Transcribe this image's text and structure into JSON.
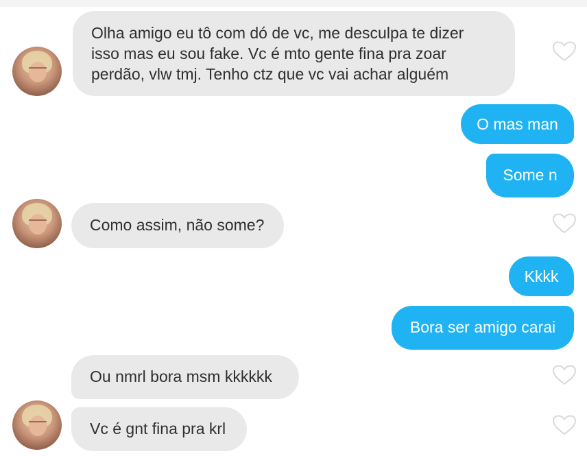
{
  "conversation": {
    "messages": [
      {
        "sender": "them",
        "text": "Olha amigo eu tô com dó de vc, me desculpa te dizer\nisso mas eu sou fake. Vc é mto gente fina pra zoar\nperdão, vlw tmj. Tenho ctz que vc vai achar alguém"
      },
      {
        "sender": "me",
        "text": "O mas man"
      },
      {
        "sender": "me",
        "text": "Some n"
      },
      {
        "sender": "them",
        "text": "Como assim, não some?"
      },
      {
        "sender": "me",
        "text": "Kkkk"
      },
      {
        "sender": "me",
        "text": "Bora ser amigo carai"
      },
      {
        "sender": "them",
        "text": "Ou nmrl bora msm kkkkkk"
      },
      {
        "sender": "them",
        "text": "Vc é gnt fina pra krl"
      }
    ]
  },
  "icons": {
    "like": "heart-outline-icon",
    "avatar": "profile-photo"
  },
  "colors": {
    "incoming_bubble": "#e9e9e9",
    "outgoing_bubble": "#1fb3f3",
    "heart_outline": "#d9d9d9"
  }
}
